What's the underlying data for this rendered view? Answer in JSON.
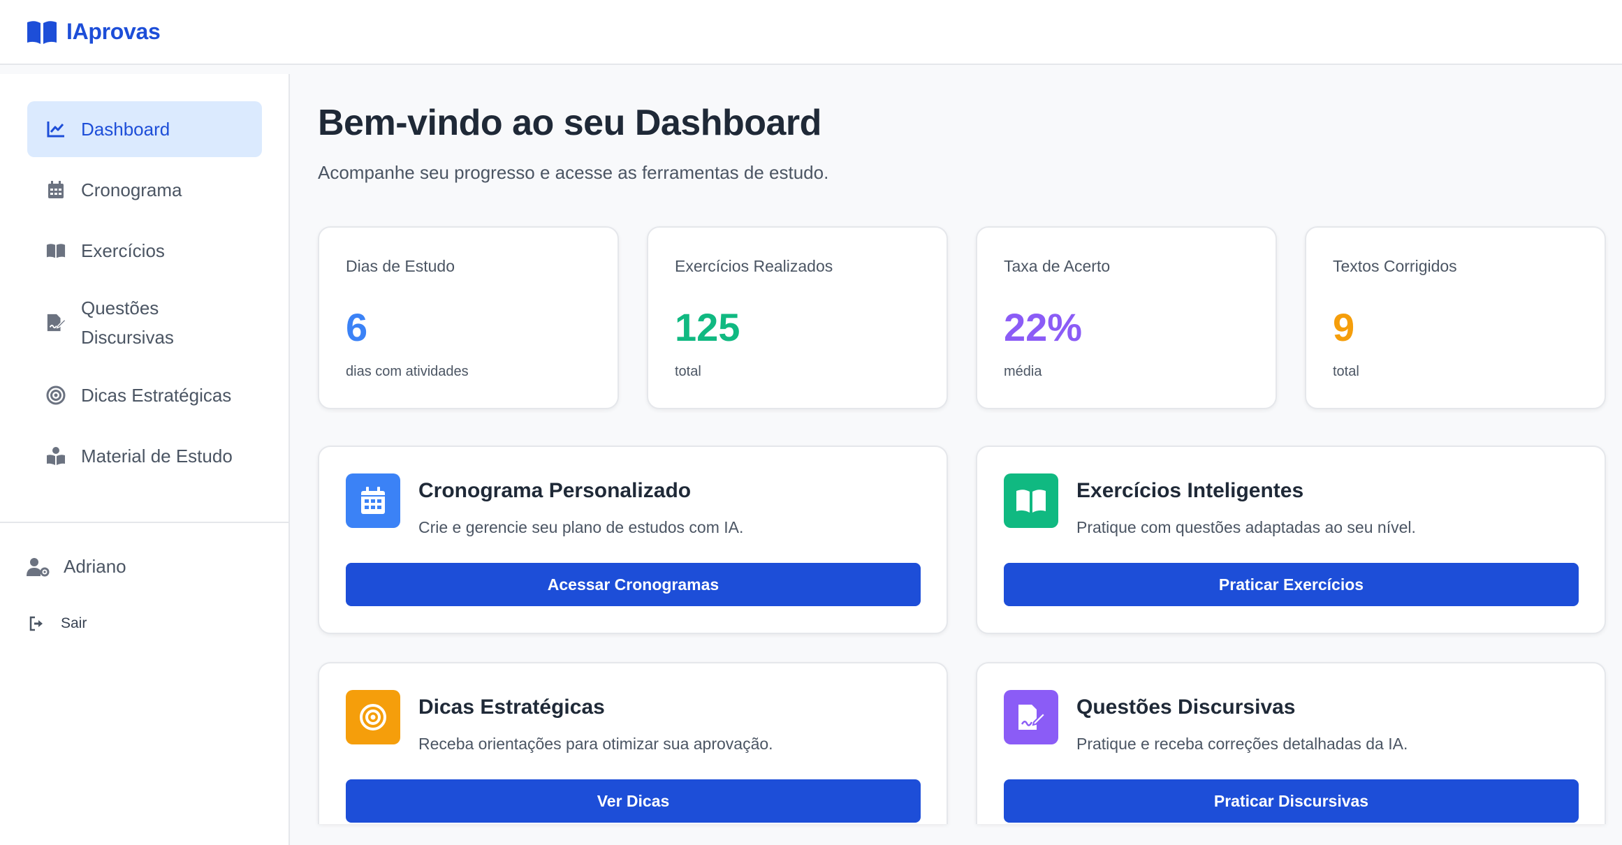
{
  "app": {
    "brand": "IAprovas",
    "brand_color": "#1d4ed8"
  },
  "sidebar": {
    "items": [
      {
        "label": "Dashboard",
        "icon": "chart-line-icon",
        "active": true
      },
      {
        "label": "Cronograma",
        "icon": "calendar-icon",
        "active": false
      },
      {
        "label": "Exercícios",
        "icon": "book-open-icon",
        "active": false
      },
      {
        "label": "Questões Discursivas",
        "icon": "file-signature-icon",
        "active": false
      },
      {
        "label": "Dicas Estratégicas",
        "icon": "bullseye-icon",
        "active": false
      },
      {
        "label": "Material de Estudo",
        "icon": "book-reader-icon",
        "active": false
      }
    ],
    "user": {
      "name": "Adriano",
      "icon": "user-cog-icon"
    },
    "logout": {
      "label": "Sair",
      "icon": "sign-out-icon"
    }
  },
  "main": {
    "title": "Bem-vindo ao seu Dashboard",
    "subtitle": "Acompanhe seu progresso e acesse as ferramentas de estudo.",
    "stats": [
      {
        "label": "Dias de Estudo",
        "value": "6",
        "sub": "dias com atividades",
        "color": "#3b82f6"
      },
      {
        "label": "Exercícios Realizados",
        "value": "125",
        "sub": "total",
        "color": "#10b981"
      },
      {
        "label": "Taxa de Acerto",
        "value": "22%",
        "sub": "média",
        "color": "#8b5cf6"
      },
      {
        "label": "Textos Corrigidos",
        "value": "9",
        "sub": "total",
        "color": "#f59e0b"
      }
    ],
    "features": [
      {
        "title": "Cronograma Personalizado",
        "desc": "Crie e gerencie seu plano de estudos com IA.",
        "button": "Acessar Cronogramas",
        "icon": "calendar-icon",
        "color": "#3b82f6"
      },
      {
        "title": "Exercícios Inteligentes",
        "desc": "Pratique com questões adaptadas ao seu nível.",
        "button": "Praticar Exercícios",
        "icon": "book-open-icon",
        "color": "#10b981"
      },
      {
        "title": "Dicas Estratégicas",
        "desc": "Receba orientações para otimizar sua aprovação.",
        "button": "Ver Dicas",
        "icon": "bullseye-icon",
        "color": "#f59e0b"
      },
      {
        "title": "Questões Discursivas",
        "desc": "Pratique e receba correções detalhadas da IA.",
        "button": "Praticar Discursivas",
        "icon": "file-signature-icon",
        "color": "#8b5cf6"
      }
    ]
  }
}
